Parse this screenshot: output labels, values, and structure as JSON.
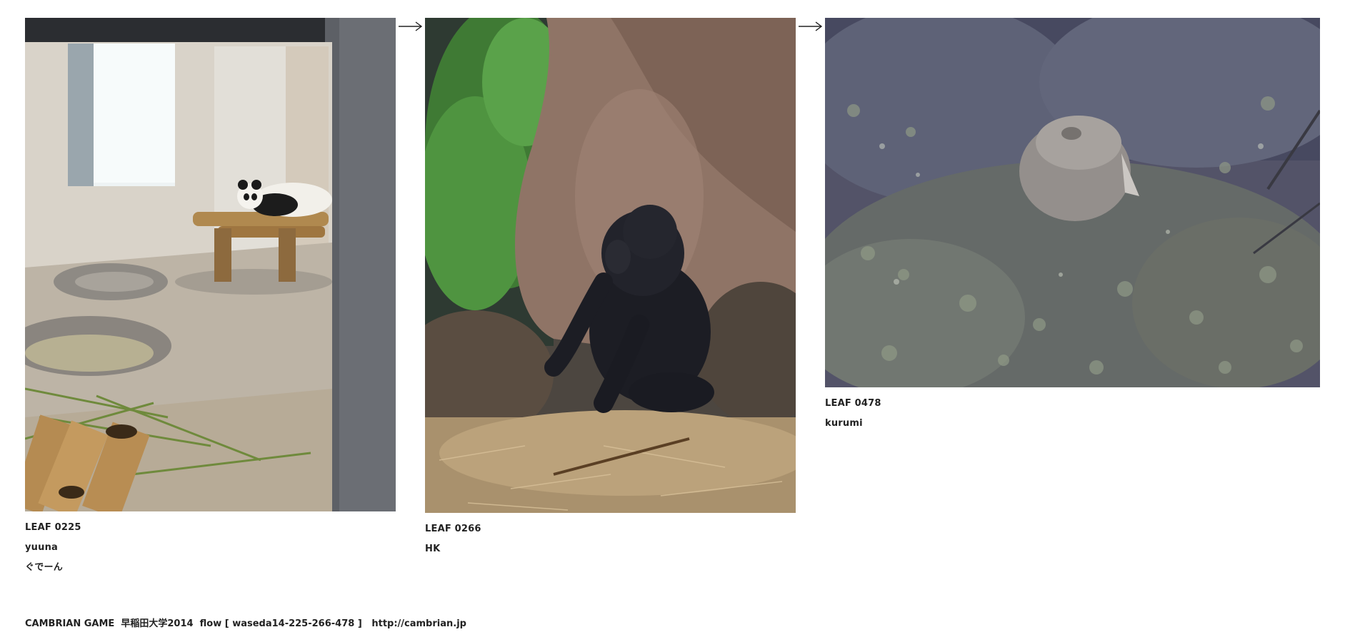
{
  "leaves": [
    {
      "leaf_id": "LEAF 0225",
      "author": "yuuna",
      "comment": "ぐでーん",
      "photo_subject": "panda"
    },
    {
      "leaf_id": "LEAF 0266",
      "author": "HK",
      "photo_subject": "gorilla"
    },
    {
      "leaf_id": "LEAF 0478",
      "author": "kurumi",
      "photo_subject": "animal in bushes"
    }
  ],
  "arrow_icon": "right-arrow-icon",
  "footer": {
    "game_title": "CAMBRIAN GAME",
    "course": "早稲田大学2014",
    "flow_label": "flow [ waseda14-225-266-478 ]",
    "url": "http://cambrian.jp"
  },
  "colors": {
    "background": "#ffffff",
    "text": "#222222"
  }
}
